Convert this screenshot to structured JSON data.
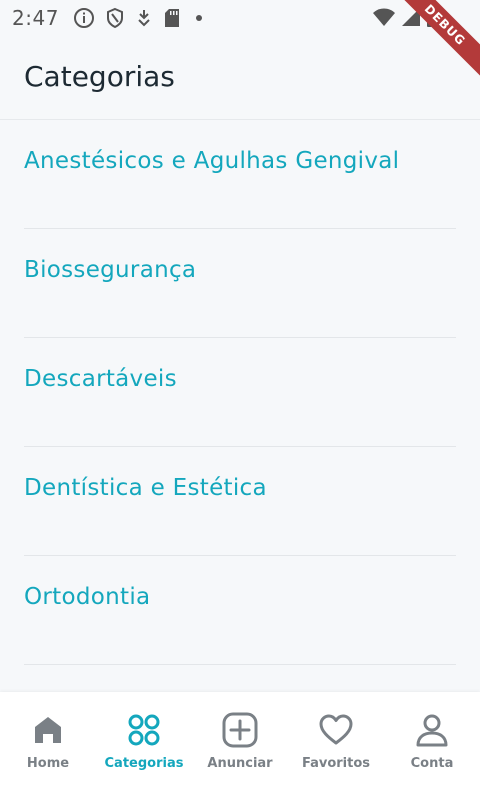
{
  "status_bar": {
    "time": "2:47",
    "icons": [
      "info-icon",
      "shield-icon",
      "download-icon",
      "sd-card-icon",
      "dot-icon",
      "wifi-icon",
      "signal-icon",
      "battery-icon"
    ]
  },
  "debug_banner": "DEBUG",
  "app_bar": {
    "title": "Categorias"
  },
  "categories": [
    {
      "label": "Anestésicos e Agulhas Gengival"
    },
    {
      "label": "Biossegurança"
    },
    {
      "label": "Descartáveis"
    },
    {
      "label": "Dentística e Estética"
    },
    {
      "label": "Ortodontia"
    }
  ],
  "bottom_nav": {
    "items": [
      {
        "label": "Home",
        "icon": "home-icon",
        "active": false
      },
      {
        "label": "Categorias",
        "icon": "grid-icon",
        "active": true
      },
      {
        "label": "Anunciar",
        "icon": "add-square-icon",
        "active": false
      },
      {
        "label": "Favoritos",
        "icon": "heart-icon",
        "active": false
      },
      {
        "label": "Conta",
        "icon": "user-icon",
        "active": false
      }
    ]
  },
  "colors": {
    "accent": "#14a7bd",
    "inactive": "#7a8086",
    "background": "#f6f8fa"
  }
}
